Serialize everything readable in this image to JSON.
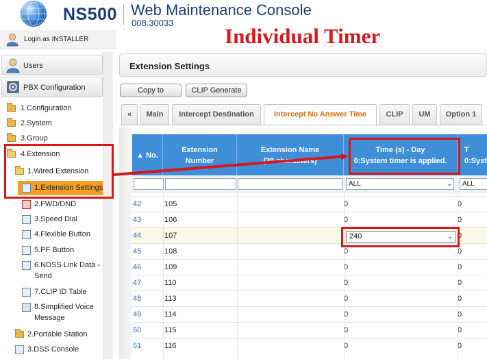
{
  "header": {
    "model": "NS500",
    "title": "Web Maintenance Console",
    "version": "008.30033",
    "overlay": "Individual Timer"
  },
  "login": {
    "text": "Login as INSTALLER"
  },
  "sidebar": {
    "users": "Users",
    "pbx": "PBX Configuration",
    "items": [
      "1.Configuration",
      "2.System",
      "3.Group",
      "4.Extension",
      "1.Wired Extension",
      "1.Extension Settings",
      "2.FWD/DND",
      "3.Speed Dial",
      "4.Flexible Button",
      "5.PF Button",
      "6.NDSS Link Data -",
      "Send",
      "7.CLIP ID Table",
      "8.Simplified Voice",
      "Message",
      "2.Portable Station",
      "3.DSS Console"
    ]
  },
  "main": {
    "title": "Extension Settings",
    "buttons": {
      "copy": "Copy to",
      "clip": "CLIP Generate"
    },
    "tabs": [
      "«",
      "Main",
      "Intercept Destination",
      "Intercept No Answer Time",
      "CLIP",
      "UM",
      "Option 1"
    ],
    "columns": {
      "no": "No.",
      "ext1": "Extension",
      "ext2": "Number",
      "name1": "Extension Name",
      "name2": "(20 characters)",
      "day1": "Time (s) - Day",
      "day2": "0:System timer is applied.",
      "next1": "T",
      "next2": "0:Syst"
    },
    "filter": {
      "all1": "ALL",
      "all2": "ALL"
    },
    "rows": [
      {
        "no": "42",
        "ext": "105",
        "val": "0",
        "val2": "0"
      },
      {
        "no": "43",
        "ext": "106",
        "val": "0",
        "val2": "0"
      },
      {
        "no": "44",
        "ext": "107",
        "val": "240",
        "val2": "0"
      },
      {
        "no": "45",
        "ext": "108",
        "val": "0",
        "val2": "0"
      },
      {
        "no": "46",
        "ext": "109",
        "val": "0",
        "val2": "0"
      },
      {
        "no": "47",
        "ext": "110",
        "val": "0",
        "val2": "0"
      },
      {
        "no": "48",
        "ext": "113",
        "val": "0",
        "val2": "0"
      },
      {
        "no": "49",
        "ext": "114",
        "val": "0",
        "val2": "0"
      },
      {
        "no": "50",
        "ext": "115",
        "val": "0",
        "val2": "0"
      },
      {
        "no": "51",
        "ext": "116",
        "val": "0",
        "val2": "0"
      }
    ]
  },
  "colors": {
    "accent": "#3e8ed8",
    "highlight": "#f5a023",
    "annotation": "#d8161b",
    "activeTab": "#d86e12"
  }
}
